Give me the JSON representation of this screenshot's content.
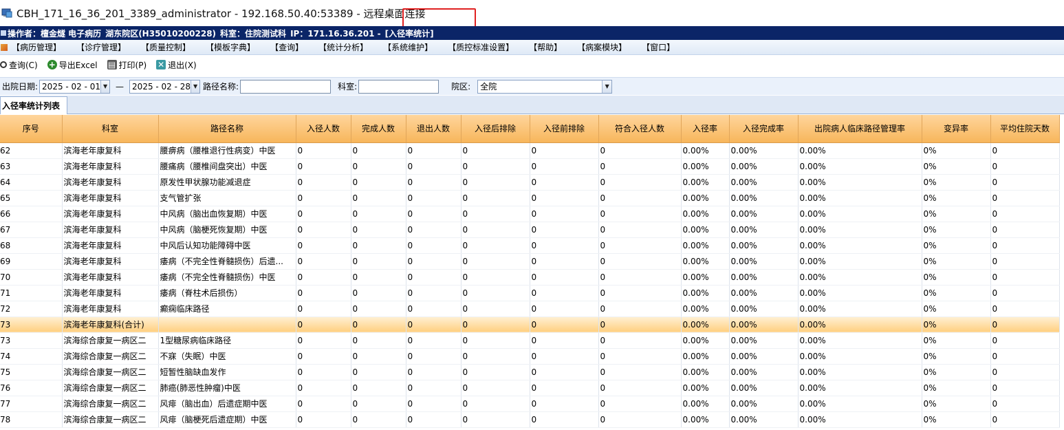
{
  "window": {
    "title": "CBH_171_16_36_201_3389_administrator - 192.168.50.40:53389 - 远程桌面连接"
  },
  "status": {
    "operator": "操作者：檀金燧 电子病历",
    "branch": "湖东院区(H35010200228)",
    "dept": "科室：住院测试科",
    "ip": "IP：171.16.36.201 -",
    "module": "[入径率统计]"
  },
  "menu": [
    "【病历管理】",
    "【诊疗管理】",
    "【质量控制】",
    "【模板字典】",
    "【查询】",
    "【统计分析】",
    "【系统维护】",
    "【质控标准设置】",
    "【帮助】",
    "【病案模块】",
    "【窗口】"
  ],
  "toolbar": {
    "query": "查询(C)",
    "export": "导出Excel",
    "print": "打印(P)",
    "exit": "退出(X)"
  },
  "filter": {
    "discharge_label": "出院日期:",
    "date_from": "2025 - 02 - 01",
    "dash": "—",
    "date_to": "2025 - 02 - 28",
    "path_label": "路径名称:",
    "path_value": "",
    "dept_label": "科室:",
    "dept_value": "",
    "campus_label": "院区:",
    "campus_value": "全院"
  },
  "tab": {
    "label": "入径率统计列表"
  },
  "table": {
    "columns": [
      "序号",
      "科室",
      "路径名称",
      "入径人数",
      "完成人数",
      "退出人数",
      "入径后排除",
      "入径前排除",
      "符合入径人数",
      "入径率",
      "入径完成率",
      "出院病人临床路径管理率",
      "变异率",
      "平均住院天数"
    ],
    "rows": [
      [
        "62",
        "滨海老年康复科",
        "腰痹病（腰椎退行性病变）中医",
        "0",
        "0",
        "0",
        "0",
        "0",
        "0",
        "0.00%",
        "0.00%",
        "0.00%",
        "0%",
        "0"
      ],
      [
        "63",
        "滨海老年康复科",
        "腰痛病（腰椎间盘突出）中医",
        "0",
        "0",
        "0",
        "0",
        "0",
        "0",
        "0.00%",
        "0.00%",
        "0.00%",
        "0%",
        "0"
      ],
      [
        "64",
        "滨海老年康复科",
        "原发性甲状腺功能减退症",
        "0",
        "0",
        "0",
        "0",
        "0",
        "0",
        "0.00%",
        "0.00%",
        "0.00%",
        "0%",
        "0"
      ],
      [
        "65",
        "滨海老年康复科",
        "支气管扩张",
        "0",
        "0",
        "0",
        "0",
        "0",
        "0",
        "0.00%",
        "0.00%",
        "0.00%",
        "0%",
        "0"
      ],
      [
        "66",
        "滨海老年康复科",
        "中风病（脑出血恢复期）中医",
        "0",
        "0",
        "0",
        "0",
        "0",
        "0",
        "0.00%",
        "0.00%",
        "0.00%",
        "0%",
        "0"
      ],
      [
        "67",
        "滨海老年康复科",
        "中风病（脑梗死恢复期）中医",
        "0",
        "0",
        "0",
        "0",
        "0",
        "0",
        "0.00%",
        "0.00%",
        "0.00%",
        "0%",
        "0"
      ],
      [
        "68",
        "滨海老年康复科",
        "中风后认知功能障碍中医",
        "0",
        "0",
        "0",
        "0",
        "0",
        "0",
        "0.00%",
        "0.00%",
        "0.00%",
        "0%",
        "0"
      ],
      [
        "69",
        "滨海老年康复科",
        "痿病（不完全性脊髓损伤）后遗...",
        "0",
        "0",
        "0",
        "0",
        "0",
        "0",
        "0.00%",
        "0.00%",
        "0.00%",
        "0%",
        "0"
      ],
      [
        "70",
        "滨海老年康复科",
        "痿病（不完全性脊髓损伤）中医",
        "0",
        "0",
        "0",
        "0",
        "0",
        "0",
        "0.00%",
        "0.00%",
        "0.00%",
        "0%",
        "0"
      ],
      [
        "71",
        "滨海老年康复科",
        "痿病（脊柱术后损伤）",
        "0",
        "0",
        "0",
        "0",
        "0",
        "0",
        "0.00%",
        "0.00%",
        "0.00%",
        "0%",
        "0"
      ],
      [
        "72",
        "滨海老年康复科",
        "癫痫临床路径",
        "0",
        "0",
        "0",
        "0",
        "0",
        "0",
        "0.00%",
        "0.00%",
        "0.00%",
        "0%",
        "0"
      ],
      [
        "73",
        "滨海老年康复科(合计)",
        "",
        "0",
        "0",
        "0",
        "0",
        "0",
        "0",
        "0.00%",
        "0.00%",
        "0.00%",
        "0%",
        "0"
      ],
      [
        "73",
        "滨海综合康复一病区二",
        "1型糖尿病临床路径",
        "0",
        "0",
        "0",
        "0",
        "0",
        "0",
        "0.00%",
        "0.00%",
        "0.00%",
        "0%",
        "0"
      ],
      [
        "74",
        "滨海综合康复一病区二",
        "不寐（失眠）中医",
        "0",
        "0",
        "0",
        "0",
        "0",
        "0",
        "0.00%",
        "0.00%",
        "0.00%",
        "0%",
        "0"
      ],
      [
        "75",
        "滨海综合康复一病区二",
        "短暂性脑缺血发作",
        "0",
        "0",
        "0",
        "0",
        "0",
        "0",
        "0.00%",
        "0.00%",
        "0.00%",
        "0%",
        "0"
      ],
      [
        "76",
        "滨海综合康复一病区二",
        "肺癌(肺恶性肿瘤)中医",
        "0",
        "0",
        "0",
        "0",
        "0",
        "0",
        "0.00%",
        "0.00%",
        "0.00%",
        "0%",
        "0"
      ],
      [
        "77",
        "滨海综合康复一病区二",
        "风痱（脑出血）后遗症期中医",
        "0",
        "0",
        "0",
        "0",
        "0",
        "0",
        "0.00%",
        "0.00%",
        "0.00%",
        "0%",
        "0"
      ],
      [
        "78",
        "滨海综合康复一病区二",
        "风痱（脑梗死后遗症期）中医",
        "0",
        "0",
        "0",
        "0",
        "0",
        "0",
        "0.00%",
        "0.00%",
        "0.00%",
        "0%",
        "0"
      ]
    ],
    "highlight_row": 11
  }
}
